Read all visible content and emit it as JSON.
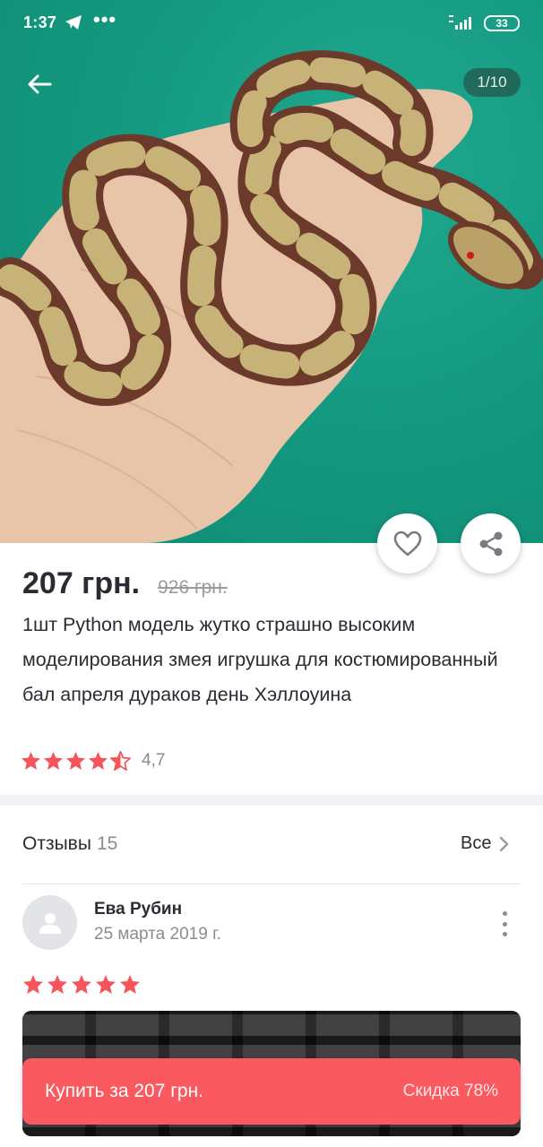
{
  "status_bar": {
    "time": "1:37",
    "dots": "•••",
    "battery": "33"
  },
  "gallery": {
    "counter": "1/10",
    "image_subject": "snake toy on palm"
  },
  "product": {
    "price": "207 грн.",
    "old_price": "926 грн.",
    "title": "1шт Python модель жутко страшно высоким моделирования змея игрушка для костюмированный бал апреля дураков день Хэллоуина",
    "rating": "4,7",
    "rating_value": 4.7
  },
  "reviews": {
    "heading": "Отзывы",
    "count": "15",
    "all_label": "Все",
    "items": [
      {
        "author": "Ева Рубин",
        "date": "25 марта 2019 г.",
        "stars": 5
      }
    ]
  },
  "buy": {
    "label": "Купить за 207 грн.",
    "discount": "Скидка 78%"
  },
  "colors": {
    "accent": "#f9595f",
    "star": "#f4545a",
    "background_teal": "#159a82"
  }
}
